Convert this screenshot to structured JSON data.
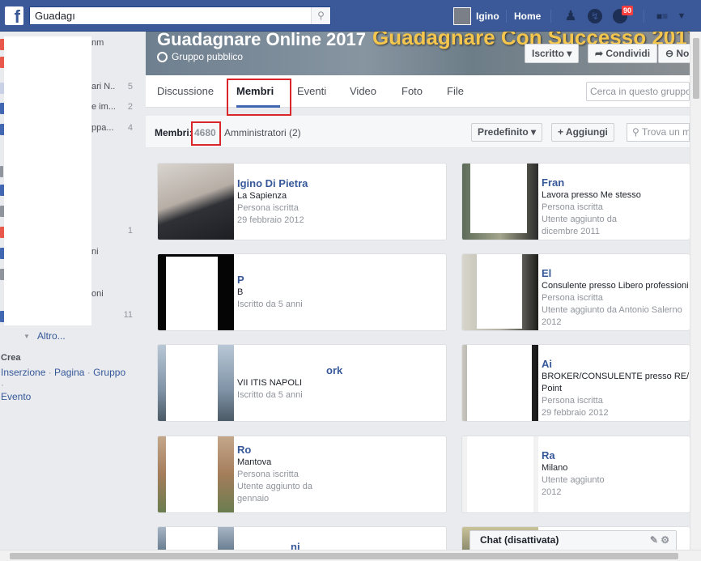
{
  "topbar": {
    "search_value": "Guadagı",
    "user_name": "Igino",
    "home_label": "Home",
    "notif_count": "90"
  },
  "left": {
    "rows": [
      {
        "frag": "nm",
        "count": ""
      },
      {
        "frag": "",
        "count": ""
      },
      {
        "frag": "ari N..",
        "count": "5"
      },
      {
        "frag": "e im...",
        "count": "2"
      },
      {
        "frag": "ppa...",
        "count": "4"
      },
      {
        "frag": "",
        "count": "1"
      },
      {
        "frag": "ni",
        "count": ""
      },
      {
        "frag": "oni",
        "count": ""
      },
      {
        "frag": "",
        "count": "11"
      }
    ],
    "altro": "Altro...",
    "crea_heading": "Crea",
    "crea_links": [
      "Inserzione",
      "Pagina",
      "Gruppo",
      "Evento"
    ]
  },
  "cover": {
    "title": "Guadagnare Online 2017",
    "banner": "Guadagnare Con Successo 2017",
    "subtitle": "Gruppo pubblico",
    "btn_joined": "Iscritto ▾",
    "btn_share": "Condividi",
    "btn_notify": "No"
  },
  "tabs": {
    "items": [
      "Discussione",
      "Membri",
      "Eventi",
      "Video",
      "Foto",
      "File"
    ],
    "search_placeholder": "Cerca in questo gruppo"
  },
  "members": {
    "label": "Membri:",
    "count": "4680",
    "admins": "Amministratori (2)",
    "sort_btn": "Predefinito ▾",
    "add_btn": "Aggiungi",
    "find_placeholder": "Trova un m"
  },
  "cards": [
    {
      "name": "Igino Di Pietra",
      "l1": "La Sapienza",
      "l2": "Persona iscritta",
      "l3": "29 febbraio 2012",
      "l4": ""
    },
    {
      "name": "Fran",
      "l1": "Lavora presso Me stesso",
      "l2": "Persona iscritta",
      "l3": "Utente aggiunto da",
      "l4": "dicembre 2011"
    },
    {
      "name": "P",
      "l1": "B",
      "l2": "Iscritto da 5 anni",
      "l3": "",
      "l4": ""
    },
    {
      "name": "El",
      "l1": "Consulente presso Libero professioni",
      "l2": "Persona iscritta",
      "l3": "Utente aggiunto da Antonio Salerno",
      "l4": "2012"
    },
    {
      "name": "ork",
      "l1": "VII ITIS NAPOLI",
      "l2": "Iscritto da 5 anni",
      "l3": "",
      "l4": ""
    },
    {
      "name": "Ai",
      "l1": "BROKER/CONSULENTE presso RE/",
      "l2": "Point",
      "l3": "Persona iscritta",
      "l4": "29 febbraio 2012"
    },
    {
      "name": "Ro",
      "l1": "Mantova",
      "l2": "Persona iscritta",
      "l3": "Utente aggiunto da",
      "l4": "gennaio"
    },
    {
      "name": "Ra",
      "l1": "Milano",
      "l2": "Utente aggiunto",
      "l3": "2012",
      "l4": ""
    },
    {
      "name": "ni",
      "l1": "",
      "l2": "",
      "l3": "",
      "l4": ""
    }
  ],
  "chat": {
    "label": "Chat (disattivata)"
  },
  "colors": {
    "brand": "#3b5998",
    "link": "#365899",
    "highlight": "#d9262b"
  }
}
